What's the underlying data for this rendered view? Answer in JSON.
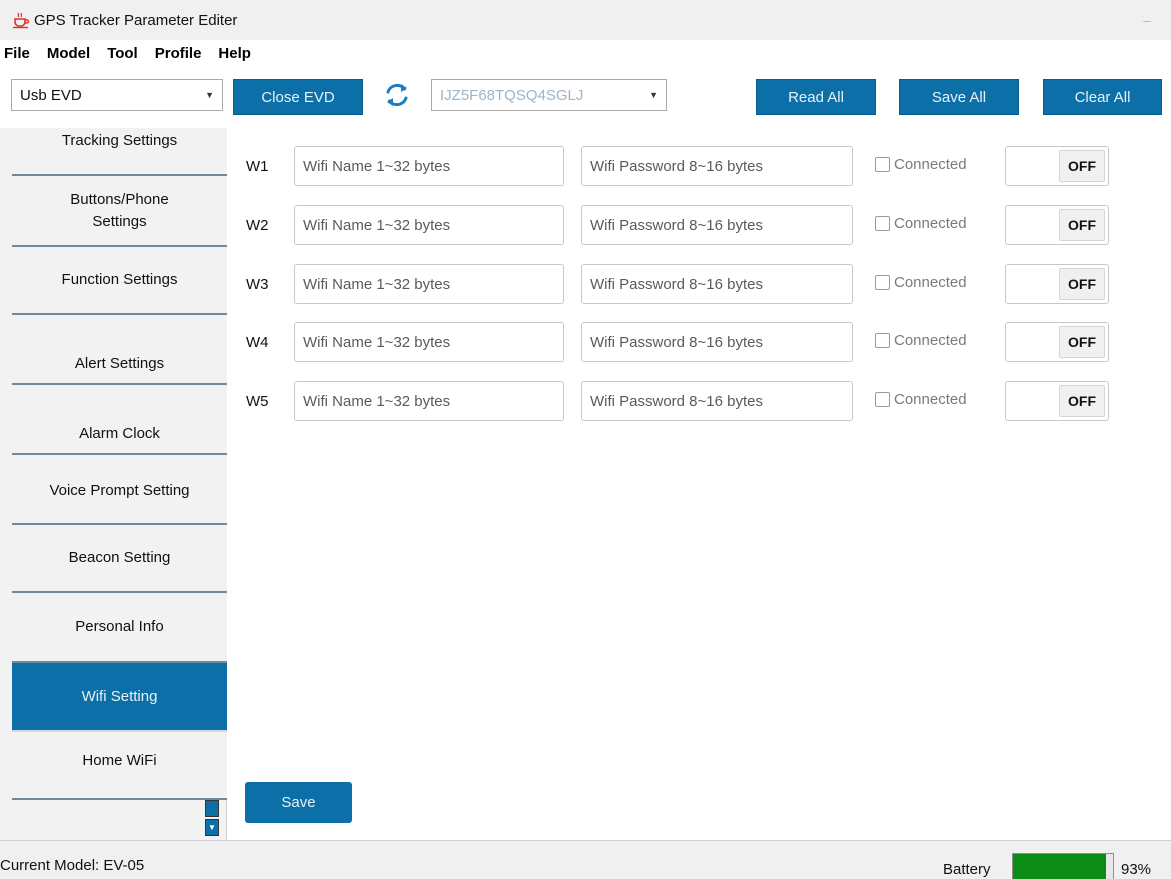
{
  "window": {
    "title": "GPS Tracker Parameter Editer",
    "minimize_glyph": "–"
  },
  "menu": {
    "items": [
      "File",
      "Model",
      "Tool",
      "Profile",
      "Help"
    ]
  },
  "toolbar": {
    "connection_select": {
      "value": "Usb EVD"
    },
    "close_label": "Close EVD",
    "refresh_icon": "refresh-icon",
    "device_select": {
      "value": "IJZ5F68TQSQ4SGLJ"
    },
    "read_all_label": "Read All",
    "save_all_label": "Save All",
    "clear_all_label": "Clear All",
    "accent_color": "#0d6fa8"
  },
  "sidebar": {
    "items": [
      {
        "label": "Tracking Settings",
        "active": false
      },
      {
        "label": "Buttons/Phone\nSettings",
        "active": false
      },
      {
        "label": "Function Settings",
        "active": false
      },
      {
        "label": "Alert Settings",
        "active": false
      },
      {
        "label": "Alarm Clock",
        "active": false
      },
      {
        "label": "Voice Prompt Setting",
        "active": false
      },
      {
        "label": "Beacon Setting",
        "active": false
      },
      {
        "label": "Personal Info",
        "active": false
      },
      {
        "label": "Wifi Setting",
        "active": true
      },
      {
        "label": "Home WiFi",
        "active": false
      }
    ]
  },
  "wifi": {
    "rows": [
      {
        "label": "W1",
        "name_placeholder": "Wifi Name 1~32 bytes",
        "password_placeholder": "Wifi Password 8~16 bytes",
        "connected_label": "Connected",
        "connected": false,
        "toggle_label": "OFF"
      },
      {
        "label": "W2",
        "name_placeholder": "Wifi Name 1~32 bytes",
        "password_placeholder": "Wifi Password 8~16 bytes",
        "connected_label": "Connected",
        "connected": false,
        "toggle_label": "OFF"
      },
      {
        "label": "W3",
        "name_placeholder": "Wifi Name 1~32 bytes",
        "password_placeholder": "Wifi Password 8~16 bytes",
        "connected_label": "Connected",
        "connected": false,
        "toggle_label": "OFF"
      },
      {
        "label": "W4",
        "name_placeholder": "Wifi Name 1~32 bytes",
        "password_placeholder": "Wifi Password 8~16 bytes",
        "connected_label": "Connected",
        "connected": false,
        "toggle_label": "OFF"
      },
      {
        "label": "W5",
        "name_placeholder": "Wifi Name 1~32 bytes",
        "password_placeholder": "Wifi Password 8~16 bytes",
        "connected_label": "Connected",
        "connected": false,
        "toggle_label": "OFF"
      }
    ],
    "save_label": "Save"
  },
  "status": {
    "model_text": "Current Model: EV-05",
    "battery_label": "Battery",
    "battery_percent": 93,
    "battery_text": "93%",
    "battery_color": "#0c8c14"
  }
}
